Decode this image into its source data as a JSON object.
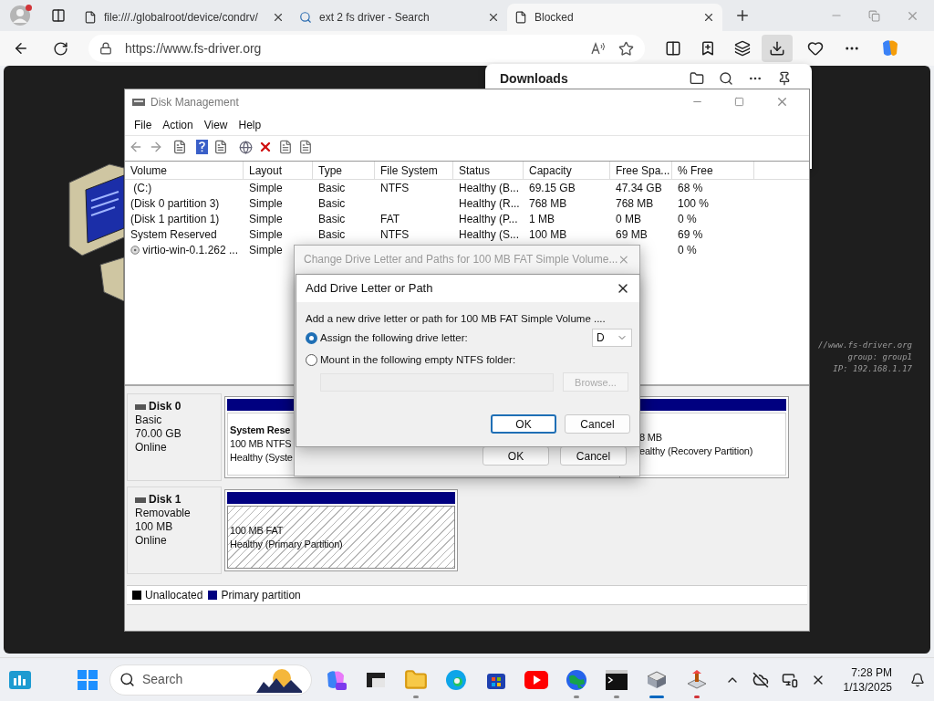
{
  "browser": {
    "tabs": [
      {
        "title": "file:///./globalroot/device/condrv/",
        "selected": false
      },
      {
        "title": "ext 2 fs driver - Search",
        "selected": false
      },
      {
        "title": "Blocked",
        "selected": true
      }
    ],
    "address": "https://www.fs-driver.org",
    "downloads_panel": {
      "title": "Downloads"
    }
  },
  "desktop": {
    "caption_lines": [
      "//www.fs-driver.org",
      "group: group1",
      "IP: 192.168.1.17"
    ]
  },
  "disk_management": {
    "title": "Disk Management",
    "active": false,
    "menu": [
      "File",
      "Action",
      "View",
      "Help"
    ],
    "columns": [
      "Volume",
      "Layout",
      "Type",
      "File System",
      "Status",
      "Capacity",
      "Free Spa...",
      "% Free"
    ],
    "rows": [
      {
        "kind": "drive",
        "cells": {
          "volume": " (C:)",
          "layout": "Simple",
          "type": "Basic",
          "file_system": "NTFS",
          "status": "Healthy (B...",
          "capacity": "69.15 GB",
          "free_space": "47.34 GB",
          "percent_free": "68 %"
        }
      },
      {
        "kind": "drive",
        "cells": {
          "volume": "(Disk 0 partition 3)",
          "layout": "Simple",
          "type": "Basic",
          "status": "Healthy (R...",
          "capacity": "768 MB",
          "free_space": "768 MB",
          "percent_free": "100 %"
        }
      },
      {
        "kind": "drive",
        "cells": {
          "volume": "(Disk 1 partition 1)",
          "layout": "Simple",
          "type": "Basic",
          "file_system": "FAT",
          "status": "Healthy (P...",
          "capacity": "1 MB",
          "free_space": "0 MB",
          "percent_free": "0 %"
        }
      },
      {
        "kind": "drive",
        "cells": {
          "volume": "System Reserved",
          "layout": "Simple",
          "type": "Basic",
          "file_system": "NTFS",
          "status": "Healthy (S...",
          "capacity": "100 MB",
          "free_space": "69 MB",
          "percent_free": "69 %"
        }
      },
      {
        "kind": "disc",
        "cells": {
          "volume": "virtio-win-0.1.262 ...",
          "layout": "Simple",
          "percent_free": "0 %"
        }
      }
    ],
    "disks": [
      {
        "name": "Disk 0",
        "type": "Basic",
        "size": "70.00 GB",
        "status": "Online",
        "partitions": [
          {
            "title": "System Rese",
            "lines": [
              "100 MB NTFS",
              "Healthy (Syste"
            ],
            "selected": false
          },
          {
            "lines": [
              "8 MB",
              "ealthy (Recovery Partition)"
            ],
            "selected": false
          }
        ]
      },
      {
        "name": "Disk 1",
        "type": "Removable",
        "size": "100 MB",
        "status": "Online",
        "partitions": [
          {
            "lines": [
              "100 MB FAT",
              "Healthy (Primary Partition)"
            ],
            "selected": true
          }
        ]
      }
    ],
    "legend": [
      {
        "label": "Unallocated",
        "color": "#000000"
      },
      {
        "label": "Primary partition",
        "color": "#000080"
      }
    ]
  },
  "change_dialog": {
    "title": "Change Drive Letter and Paths for 100 MB FAT Simple Volume...",
    "active": false,
    "buttons": [
      {
        "label": "OK",
        "default": false
      },
      {
        "label": "Cancel",
        "default": false
      }
    ]
  },
  "add_dialog": {
    "title": "Add Drive Letter or Path",
    "active": true,
    "description": "Add a new drive letter or path for 100 MB FAT Simple Volume ....",
    "options": [
      {
        "label": "Assign the following drive letter:",
        "selected": true
      },
      {
        "label": "Mount in the following empty NTFS folder:",
        "selected": false
      }
    ],
    "drive_letter": "D",
    "browse": {
      "label": "Browse...",
      "disabled": true
    },
    "buttons": [
      {
        "label": "OK",
        "default": true
      },
      {
        "label": "Cancel",
        "default": false
      }
    ]
  },
  "taskbar": {
    "search": {
      "placeholder": "Search"
    },
    "apps": [
      {
        "kind": "copilot",
        "running": false,
        "focused": false,
        "attention": false
      },
      {
        "kind": "window",
        "running": false,
        "focused": false,
        "attention": false
      },
      {
        "kind": "folder",
        "running": true,
        "focused": false,
        "attention": false
      },
      {
        "kind": "browser",
        "running": false,
        "focused": false,
        "attention": false
      },
      {
        "kind": "store",
        "running": false,
        "focused": false,
        "attention": false
      },
      {
        "kind": "video",
        "running": false,
        "focused": false,
        "attention": false
      },
      {
        "kind": "globe",
        "running": true,
        "focused": false,
        "attention": false
      },
      {
        "kind": "terminal",
        "running": true,
        "focused": false,
        "attention": false
      },
      {
        "kind": "drive",
        "running": true,
        "focused": true,
        "attention": false
      },
      {
        "kind": "tool",
        "running": true,
        "focused": false,
        "attention": true
      }
    ],
    "time": "7:28 PM",
    "date": "1/13/2025"
  }
}
